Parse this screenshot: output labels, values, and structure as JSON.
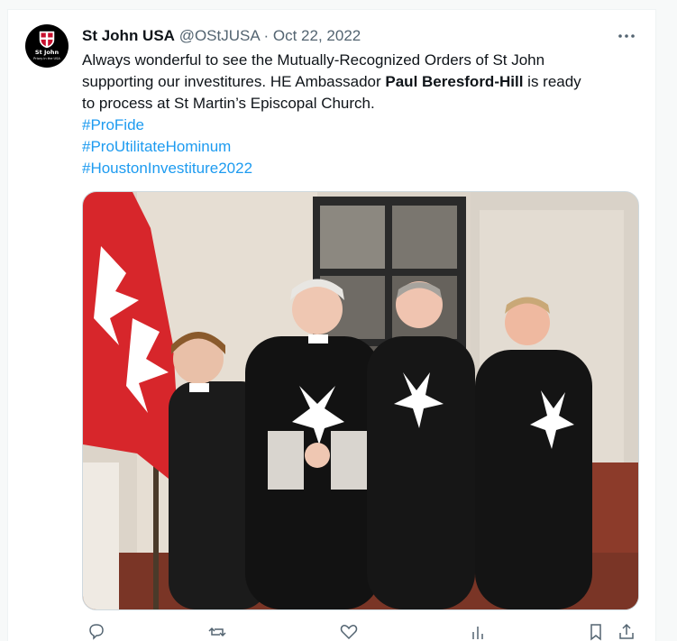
{
  "tweet": {
    "author_name": "St John USA",
    "author_handle": "@OStJUSA",
    "separator": "·",
    "date": "Oct 22, 2022",
    "text_line1": "Always wonderful to see the Mutually-Recognized Orders of St John",
    "text_line2": "supporting our investitures. HE Ambassador ",
    "text_line2_bold": "Paul Beresford-Hill",
    "text_line2_end": " is ready",
    "text_line3": "to process at St Martin’s Episcopal Church.",
    "hashtags": [
      "#ProFide",
      "#ProUtilitateHominum",
      "#HoustonInvestiture2022"
    ]
  },
  "avatar": {
    "title": "St John",
    "subtitle": "Priory in the USA"
  },
  "colors": {
    "link": "#1d9bf0",
    "muted": "#536471",
    "text": "#0f1419",
    "flag_red": "#d7262b"
  },
  "icons": {
    "more": "more-dots-icon",
    "reply": "reply-icon",
    "retweet": "retweet-icon",
    "like": "heart-icon",
    "views": "views-icon",
    "bookmark": "bookmark-icon",
    "share": "share-icon"
  }
}
